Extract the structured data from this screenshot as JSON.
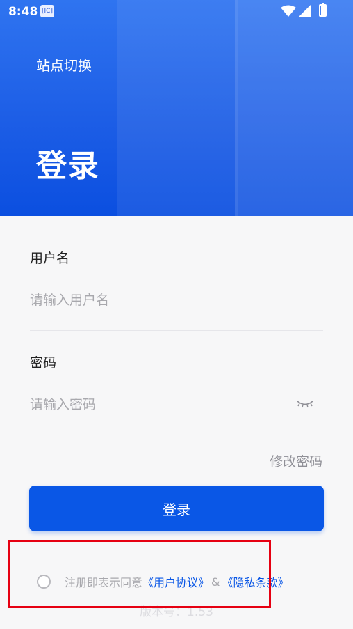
{
  "status_bar": {
    "time": "8:48",
    "app_icon_text": "[IC]"
  },
  "header": {
    "site_switch": "站点切换",
    "title": "登录"
  },
  "form": {
    "username_label": "用户名",
    "username_placeholder": "请输入用户名",
    "password_label": "密码",
    "password_placeholder": "请输入密码",
    "change_password": "修改密码",
    "login_button": "登录"
  },
  "agreement": {
    "prefix": "注册即表示同意",
    "user_agreement": "《用户协议》",
    "amp": "&",
    "privacy_terms": "《隐私条款》"
  },
  "version": "版本号：1.53",
  "colors": {
    "primary": "#0a57e6",
    "highlight": "#e60012"
  }
}
